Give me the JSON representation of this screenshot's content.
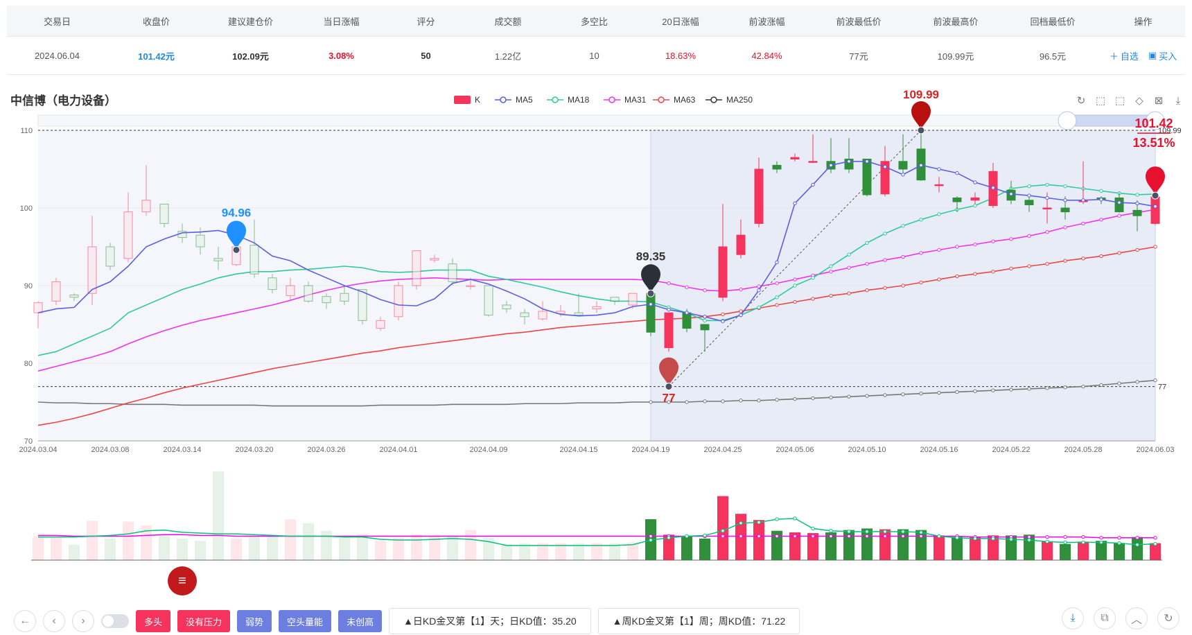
{
  "summary": {
    "headers": [
      "交易日",
      "收盘价",
      "建议建仓价",
      "当日涨幅",
      "评分",
      "成交额",
      "多空比",
      "20日涨幅",
      "前波涨幅",
      "前波最低价",
      "前波最高价",
      "回档最低价",
      "操作"
    ],
    "row": {
      "date": "2024.06.04",
      "close": "101.42元",
      "suggest": "102.09元",
      "change": "3.08%",
      "score": "50",
      "amount": "1.22亿",
      "ratio": "10",
      "chg20": "18.63%",
      "wave_chg": "42.84%",
      "wave_low": "77元",
      "wave_high": "109.99元",
      "pullback_low": "96.5元"
    },
    "ops": {
      "watch": "自选",
      "buy": "买入"
    }
  },
  "stock_title": "中信博（电力设备）",
  "legend": [
    "K",
    "MA5",
    "MA18",
    "MA31",
    "MA63",
    "MA250"
  ],
  "toolbar": {
    "tags": [
      "多头",
      "没有压力",
      "弱势",
      "空头量能",
      "未创高"
    ],
    "info1": "▲日KD金叉第【1】天；日KD值：35.20",
    "info2": "▲周KD金叉第【1】周；周KD值：71.22"
  },
  "colors": {
    "up": "#f5335d",
    "down": "#2f8f3a",
    "ma5": "#5b5fe0",
    "ma18": "#2ec9a0",
    "ma31": "#ee33ee",
    "ma63": "#ea4545",
    "ma250": "#333333"
  },
  "chart_data": {
    "type": "candlestick",
    "ylim": [
      70,
      110
    ],
    "yticks": [
      70,
      80,
      90,
      100,
      110
    ],
    "xticks": [
      "2024.03.04",
      "2024.03.08",
      "2024.03.14",
      "2024.03.20",
      "2024.03.26",
      "2024.04.01",
      "2024.04.09",
      "2024.04.15",
      "2024.04.19",
      "2024.04.25",
      "2024.05.06",
      "2024.05.10",
      "2024.05.16",
      "2024.05.22",
      "2024.05.28",
      "2024.06.03"
    ],
    "markers": {
      "high1": "94.96",
      "mid": "89.35",
      "low": "77",
      "high2": "109.99",
      "last": "101.42",
      "last_pct": "13.51%",
      "line_high": "109.99",
      "line_low": "77"
    },
    "candles": [
      [
        86.5,
        87.8,
        84.5,
        88
      ],
      [
        88,
        90.5,
        87.5,
        91
      ],
      [
        88.8,
        88.5,
        88,
        89
      ],
      [
        89,
        95,
        87.5,
        99
      ],
      [
        95,
        92.5,
        92,
        95.5
      ],
      [
        93.5,
        99.5,
        93,
        102
      ],
      [
        99.5,
        101,
        99,
        105.5
      ],
      [
        100.5,
        98,
        97.5,
        100.5
      ],
      [
        97,
        96.2,
        95.5,
        98
      ],
      [
        96.5,
        95,
        94,
        97.5
      ],
      [
        93.5,
        93.2,
        92,
        95
      ],
      [
        92.7,
        95,
        92.5,
        95.5
      ],
      [
        95.2,
        91.5,
        91,
        98.5
      ],
      [
        91,
        89.5,
        89,
        91.5
      ],
      [
        88.7,
        90,
        88,
        91
      ],
      [
        90,
        88,
        87.8,
        90.5
      ],
      [
        88.6,
        87.8,
        87,
        89
      ],
      [
        89,
        88,
        87.5,
        90
      ],
      [
        89.5,
        85.5,
        85,
        89.5
      ],
      [
        84.5,
        85.5,
        84.2,
        86
      ],
      [
        86,
        90,
        85.5,
        90.5
      ],
      [
        90,
        94.5,
        89.5,
        94.5
      ],
      [
        93.3,
        93.5,
        93,
        94
      ],
      [
        92.8,
        90.5,
        90,
        93.5
      ],
      [
        90,
        90,
        89.5,
        91
      ],
      [
        90,
        86.2,
        86,
        90
      ],
      [
        87.5,
        87,
        86.5,
        88
      ],
      [
        86.5,
        86,
        85,
        87
      ],
      [
        85.7,
        86.7,
        85.5,
        88
      ],
      [
        86.4,
        86.7,
        86,
        87.5
      ],
      [
        86.5,
        86.2,
        86,
        89
      ],
      [
        87,
        87.3,
        86.5,
        88
      ],
      [
        88.5,
        88,
        87.5,
        88.5
      ],
      [
        87.5,
        89,
        87,
        89
      ],
      [
        89,
        84,
        83.5,
        89.5
      ],
      [
        82,
        86.5,
        81.5,
        86.5
      ],
      [
        86.5,
        84.5,
        84,
        87
      ],
      [
        85,
        84.3,
        81.5,
        85
      ],
      [
        88.5,
        95,
        88,
        100.5
      ],
      [
        94,
        96.5,
        93.5,
        98.5
      ],
      [
        98,
        105,
        97.5,
        106.5
      ],
      [
        105.5,
        105,
        104.5,
        106
      ],
      [
        106.3,
        106.5,
        106,
        107
      ],
      [
        106,
        106,
        105.8,
        109.5
      ],
      [
        106,
        105,
        104.5,
        109
      ],
      [
        106.3,
        105,
        104.5,
        109
      ],
      [
        106.3,
        101.7,
        101.5,
        106.3
      ],
      [
        101.8,
        106,
        101.5,
        108
      ],
      [
        106,
        105,
        104.5,
        109.5
      ],
      [
        107.6,
        103.6,
        103.5,
        109.99
      ],
      [
        103,
        103,
        102,
        104
      ],
      [
        101.3,
        100.8,
        99.5,
        101.5
      ],
      [
        101,
        101.3,
        100.5,
        102
      ],
      [
        100.3,
        104.7,
        100,
        105.8
      ],
      [
        102.3,
        101,
        100.5,
        103.5
      ],
      [
        101,
        100.4,
        99.5,
        101.5
      ],
      [
        100,
        100,
        98,
        102
      ],
      [
        100,
        99.5,
        98.5,
        101.5
      ],
      [
        100.8,
        101,
        100.5,
        106
      ],
      [
        101.3,
        101.1,
        100.5,
        101.5
      ],
      [
        101.3,
        99.5,
        99.4,
        102
      ],
      [
        99.7,
        99,
        97,
        101
      ],
      [
        98,
        101.42,
        97.8,
        102
      ]
    ],
    "ma5": [
      86.5,
      87,
      87.2,
      89.5,
      90.5,
      92.5,
      95,
      96,
      96.8,
      96.9,
      97.1,
      96.5,
      95.5,
      93.8,
      93.2,
      92,
      91,
      90,
      89.2,
      88.2,
      87.5,
      87.4,
      88.3,
      90.3,
      90.8,
      90.2,
      89.3,
      88.3,
      87,
      86.3,
      86.1,
      86.2,
      86.5,
      87.3,
      87.6,
      86.9,
      86.5,
      86,
      85.4,
      86.2,
      89.4,
      93,
      100.6,
      103,
      105.5,
      106,
      106,
      105.3,
      104.3,
      105.5,
      105,
      104.5,
      103.3,
      102.6,
      101.8,
      101.6,
      101.3,
      101,
      101,
      101.1,
      100.7,
      100.6,
      100.2
    ],
    "ma18": [
      81,
      81.5,
      82.5,
      83.5,
      84.5,
      86.5,
      87.5,
      88.5,
      89.5,
      90.2,
      91,
      91.5,
      91.8,
      91.8,
      92,
      92.1,
      92.3,
      92.5,
      92.3,
      91.8,
      91.7,
      91.8,
      92,
      92,
      92,
      91.2,
      90.8,
      90.3,
      89.8,
      89.2,
      88.7,
      88.3,
      88,
      88,
      87.9,
      87.2,
      86.5,
      85.5,
      85.5,
      86.2,
      87.2,
      88.5,
      90,
      91,
      92.5,
      94,
      95.5,
      96.7,
      97.7,
      98.5,
      99.2,
      99.8,
      100.3,
      101.3,
      102.5,
      102.8,
      103,
      102.8,
      102.5,
      102.2,
      101.9,
      101.7,
      101.8
    ],
    "ma31": [
      79,
      79.6,
      80.2,
      80.8,
      81.5,
      82.5,
      83.4,
      84.2,
      84.9,
      85.5,
      86,
      86.5,
      87,
      87.5,
      88.1,
      88.8,
      89.4,
      89.9,
      90.3,
      90.6,
      90.8,
      90.9,
      91,
      90.9,
      90.8,
      90.7,
      90.8,
      90.8,
      90.8,
      90.8,
      90.8,
      90.8,
      90.8,
      90.8,
      90.7,
      90.3,
      89.8,
      89.4,
      89.3,
      89.5,
      89.9,
      90.3,
      90.8,
      91.3,
      91.8,
      92.3,
      92.8,
      93.3,
      93.7,
      94.2,
      94.6,
      95,
      95.3,
      95.7,
      96,
      96.4,
      96.9,
      97.5,
      98,
      98.5,
      99,
      99.4,
      99.8
    ],
    "ma63": [
      72,
      72.4,
      72.9,
      73.5,
      74.2,
      74.9,
      75.5,
      76.2,
      76.8,
      77.3,
      77.8,
      78.3,
      78.8,
      79.3,
      79.7,
      80.1,
      80.5,
      80.9,
      81.3,
      81.6,
      82,
      82.3,
      82.6,
      82.9,
      83.2,
      83.5,
      83.8,
      84,
      84.3,
      84.6,
      84.8,
      85,
      85.2,
      85.4,
      85.6,
      85.7,
      85.8,
      86,
      86.3,
      86.7,
      87.1,
      87.5,
      87.9,
      88.3,
      88.7,
      89,
      89.4,
      89.7,
      90,
      90.4,
      90.8,
      91.2,
      91.5,
      91.8,
      92.2,
      92.5,
      92.8,
      93.2,
      93.5,
      93.8,
      94.2,
      94.6,
      95
    ],
    "ma250": [
      75,
      74.9,
      74.9,
      74.8,
      74.8,
      74.7,
      74.7,
      74.7,
      74.6,
      74.6,
      74.6,
      74.6,
      74.6,
      74.5,
      74.5,
      74.5,
      74.5,
      74.5,
      74.5,
      74.6,
      74.6,
      74.6,
      74.6,
      74.7,
      74.7,
      74.7,
      74.7,
      74.8,
      74.8,
      74.8,
      74.9,
      74.9,
      74.9,
      75,
      75,
      75,
      75,
      75.1,
      75.1,
      75.2,
      75.2,
      75.3,
      75.4,
      75.5,
      75.6,
      75.7,
      75.8,
      75.9,
      76,
      76.1,
      76.2,
      76.3,
      76.4,
      76.5,
      76.6,
      76.7,
      76.8,
      76.9,
      77,
      77.2,
      77.4,
      77.6,
      77.8
    ],
    "volume": [
      30,
      29,
      20,
      51,
      28,
      50,
      45,
      33,
      28,
      25,
      115,
      28,
      31,
      33,
      53,
      48,
      38,
      32,
      34,
      25,
      29,
      33,
      31,
      32,
      39,
      29,
      21,
      22,
      22,
      22,
      22,
      22,
      22,
      23,
      53,
      33,
      31,
      28,
      83,
      60,
      52,
      38,
      36,
      35,
      36,
      39,
      41,
      40,
      40,
      39,
      32,
      30,
      30,
      32,
      32,
      33,
      24,
      21,
      24,
      25,
      22,
      30,
      22
    ],
    "vol_ma1": [
      32,
      32,
      31,
      31,
      31,
      31,
      32,
      33,
      33,
      32,
      32,
      31,
      31,
      31,
      31,
      31,
      31,
      31,
      31,
      31,
      31,
      31,
      31,
      31,
      31,
      31,
      31,
      31,
      31,
      31,
      31,
      31,
      31,
      31,
      31,
      31,
      31,
      31,
      31,
      31,
      31,
      31,
      31,
      31,
      31,
      31,
      31,
      31,
      31,
      31,
      31,
      31,
      30,
      30,
      30,
      30,
      30,
      30,
      30,
      29,
      29,
      29,
      29
    ],
    "vol_ma2": [
      30,
      30,
      30,
      31,
      32,
      34,
      38,
      39,
      36,
      35,
      34,
      34,
      33,
      32,
      31,
      31,
      31,
      30,
      30,
      27,
      26,
      26,
      27,
      28,
      27,
      24,
      19,
      19,
      19,
      19,
      19,
      19,
      19,
      20,
      26,
      29,
      31,
      32,
      38,
      48,
      49,
      53,
      54,
      41,
      38,
      37,
      37,
      37,
      37,
      36,
      31,
      29,
      28,
      28,
      27,
      26,
      24,
      23,
      23,
      23,
      22,
      20,
      21
    ]
  }
}
